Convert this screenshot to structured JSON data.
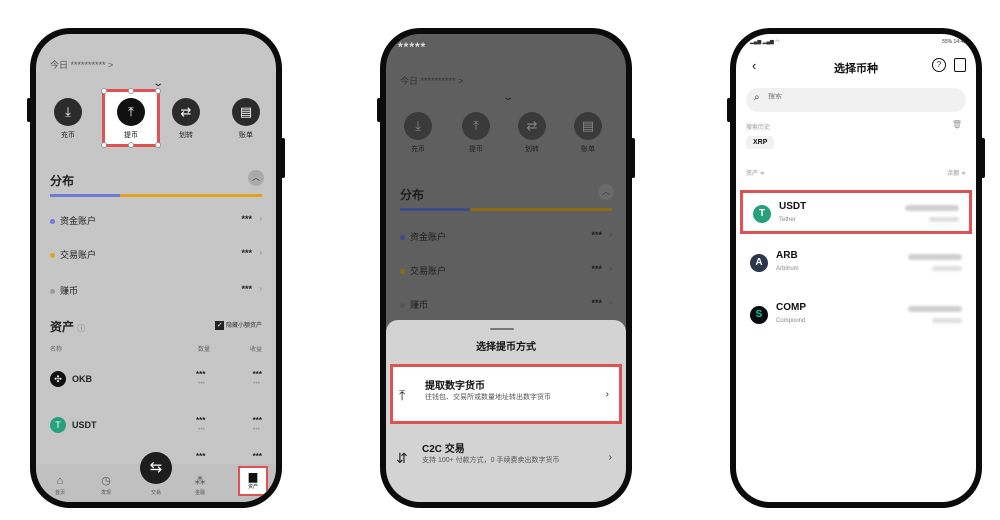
{
  "colors": {
    "highlight": "#e05252",
    "usdt": "#26a17b",
    "okb": "#111111",
    "arb": "#2d374b",
    "comp": "#070a0e",
    "fund_dot": "#6b7bd6",
    "trade_dot": "#e4a21b",
    "earn_dot": "#9a9a9a"
  },
  "phone1": {
    "today_label": "今日 ********** >",
    "actions": [
      {
        "label": "充币",
        "icon": "deposit-icon"
      },
      {
        "label": "提币",
        "icon": "withdraw-icon"
      },
      {
        "label": "划转",
        "icon": "transfer-icon"
      },
      {
        "label": "账单",
        "icon": "bill-icon"
      }
    ],
    "distribution_title": "分布",
    "accounts": [
      {
        "label": "资金账户",
        "value": "***"
      },
      {
        "label": "交易账户",
        "value": "***"
      },
      {
        "label": "赚币",
        "value": "***"
      }
    ],
    "assets_title": "资产",
    "hide_small_label": "隐藏小额资产",
    "col_name": "名称",
    "col_qty": "数量",
    "col_pnl": "收益",
    "coins": [
      {
        "name": "OKB",
        "qty": "***",
        "qty_sub": "***",
        "pnl": "***",
        "pnl_sub": "***"
      },
      {
        "name": "USDT",
        "qty": "***",
        "qty_sub": "***",
        "pnl": "***",
        "pnl_sub": "***"
      },
      {
        "qty": "***",
        "pnl": "***"
      }
    ],
    "tabs": [
      {
        "label": "首页",
        "icon": "home-icon"
      },
      {
        "label": "发现",
        "icon": "discover-icon"
      },
      {
        "label": "交易",
        "icon": "trade-icon"
      },
      {
        "label": "金融",
        "icon": "finance-icon"
      },
      {
        "label": "资产",
        "icon": "wallet-icon"
      }
    ]
  },
  "phone2": {
    "masked_total": "*****",
    "today_label": "今日 ********** >",
    "actions": [
      {
        "label": "充币"
      },
      {
        "label": "提币"
      },
      {
        "label": "划转"
      },
      {
        "label": "账单"
      }
    ],
    "distribution_title": "分布",
    "accounts": [
      {
        "label": "资金账户",
        "value": "***"
      },
      {
        "label": "交易账户",
        "value": "***"
      },
      {
        "label": "赚币",
        "value": "***"
      }
    ],
    "sheet_title": "选择提币方式",
    "options": [
      {
        "title": "提取数字货币",
        "desc": "往钱包、交易所或数量地址转出数字货币"
      },
      {
        "title": "C2C 交易",
        "desc": "支持 100+ 付款方式，0 手续费卖出数字货币"
      }
    ]
  },
  "phone3": {
    "status_right": "55% 14:49",
    "title": "选择币种",
    "search_placeholder": "搜索",
    "history_label": "搜索历史",
    "history_chips": [
      "XRP"
    ],
    "col_asset": "资产 ≑",
    "col_balance": "余额 ≑",
    "coins": [
      {
        "symbol": "USDT",
        "name": "Tether",
        "icon_glyph": "T"
      },
      {
        "symbol": "ARB",
        "name": "Arbitrum",
        "icon_glyph": "A"
      },
      {
        "symbol": "COMP",
        "name": "Compound",
        "icon_glyph": "S"
      }
    ]
  }
}
